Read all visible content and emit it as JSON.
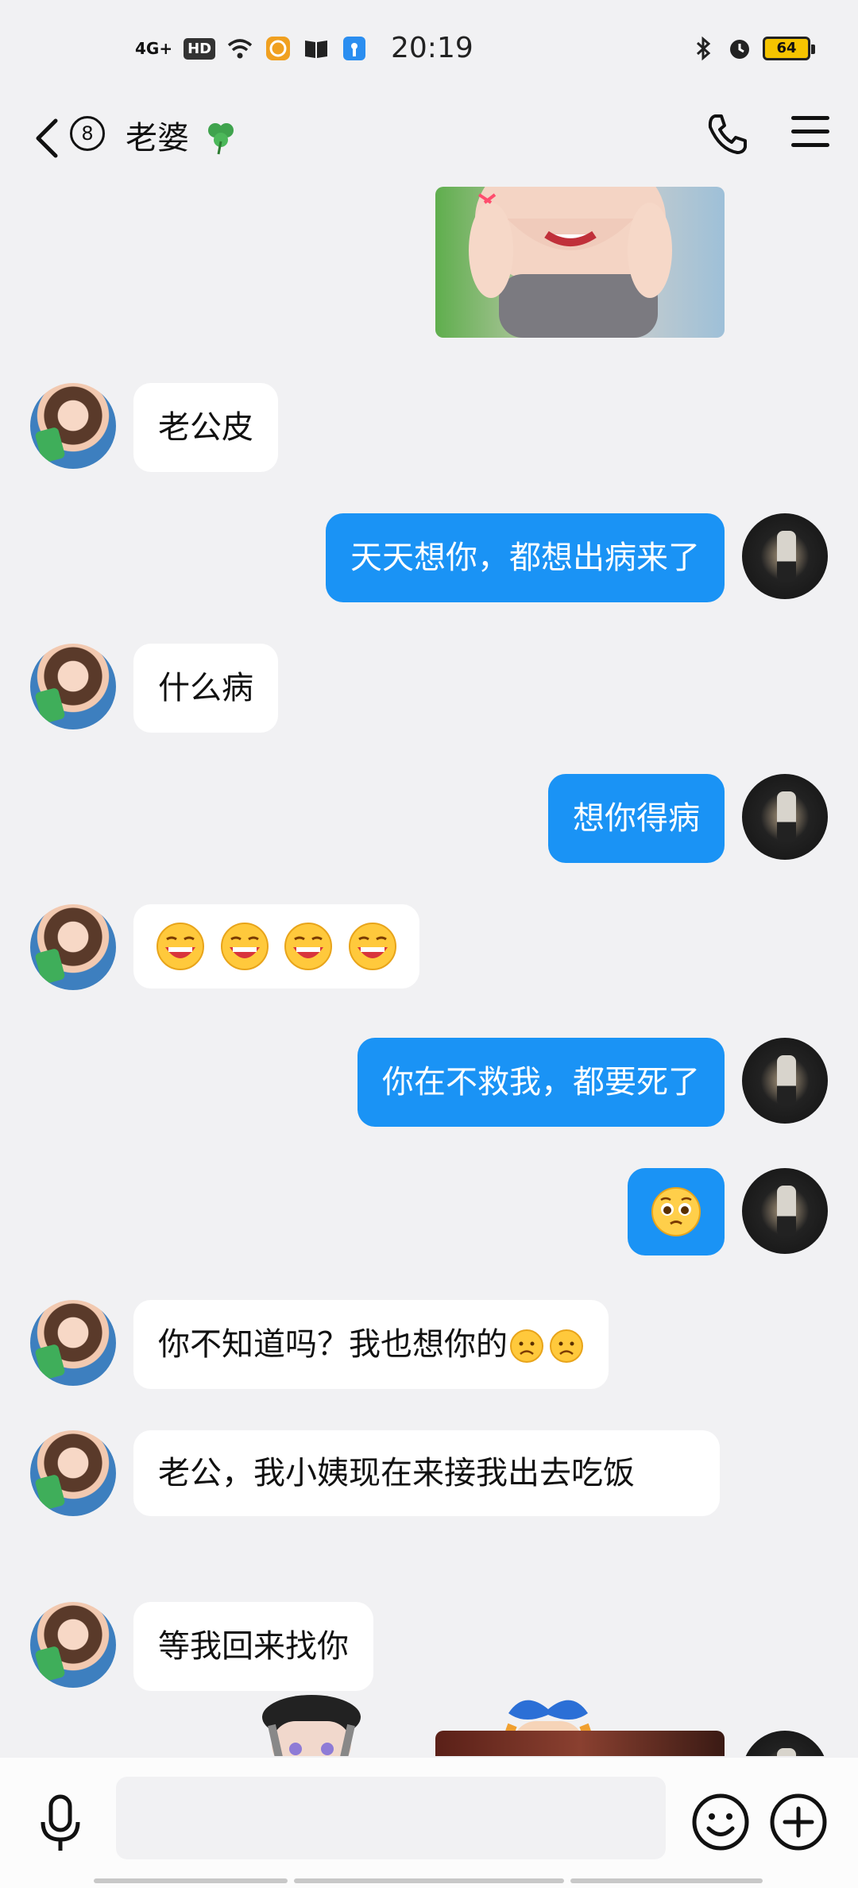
{
  "status_bar": {
    "signal": "4G+",
    "hd": "HD",
    "time": "20:19",
    "battery": "64"
  },
  "header": {
    "unread_count": "8",
    "title": "老婆",
    "title_icon": "clover-icon",
    "back_icon": "back-chevron-icon",
    "call_icon": "phone-icon",
    "menu_icon": "menu-icon"
  },
  "messages": [
    {
      "side": "out",
      "type": "image",
      "desc": "photo"
    },
    {
      "side": "in",
      "type": "text",
      "text": "老公皮"
    },
    {
      "side": "out",
      "type": "text",
      "text": "天天想你，都想出病来了"
    },
    {
      "side": "in",
      "type": "text",
      "text": "什么病"
    },
    {
      "side": "out",
      "type": "text",
      "text": "想你得病"
    },
    {
      "side": "in",
      "type": "emoji",
      "emoji": "laughing-face",
      "count": 4
    },
    {
      "side": "out",
      "type": "text",
      "text": "你在不救我，都要死了"
    },
    {
      "side": "out",
      "type": "emoji",
      "emoji": "pleading-face",
      "count": 1
    },
    {
      "side": "in",
      "type": "text",
      "text": "你不知道吗？我也想你的",
      "trailing_emoji": "sad-face",
      "trailing_count": 2
    },
    {
      "side": "in",
      "type": "text",
      "text": "老公，我小姨现在来接我出去吃饭"
    },
    {
      "side": "in",
      "type": "text",
      "text": "等我回来找你"
    }
  ],
  "input_bar": {
    "placeholder": "",
    "voice_icon": "microphone-icon",
    "emoji_icon": "smiley-icon",
    "more_icon": "plus-icon"
  },
  "colors": {
    "background": "#f1f1f3",
    "outgoing_bubble": "#1a93f5",
    "incoming_bubble": "#ffffff"
  }
}
